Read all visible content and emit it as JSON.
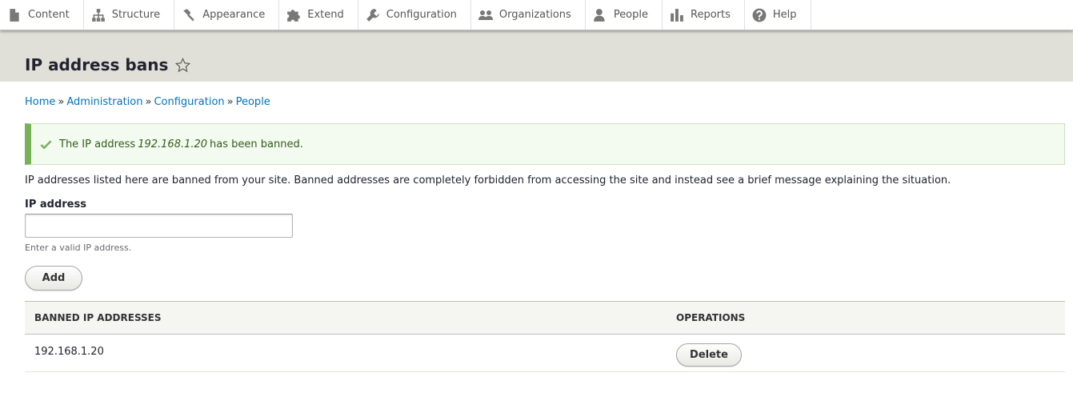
{
  "toolbar": {
    "items": [
      {
        "label": "Content",
        "icon": "file-icon"
      },
      {
        "label": "Structure",
        "icon": "sitemap-icon"
      },
      {
        "label": "Appearance",
        "icon": "paintbrush-icon"
      },
      {
        "label": "Extend",
        "icon": "puzzle-icon"
      },
      {
        "label": "Configuration",
        "icon": "wrench-icon"
      },
      {
        "label": "Organizations",
        "icon": "group-icon"
      },
      {
        "label": "People",
        "icon": "user-icon"
      },
      {
        "label": "Reports",
        "icon": "bar-chart-icon"
      },
      {
        "label": "Help",
        "icon": "help-icon"
      }
    ]
  },
  "page": {
    "title": "IP address bans"
  },
  "breadcrumb": {
    "home": "Home",
    "administration": "Administration",
    "configuration": "Configuration",
    "people": "People",
    "separator": "»"
  },
  "status": {
    "prefix": "The IP address",
    "ip": "192.168.1.20",
    "suffix": "has been banned.",
    "color": "#77b259"
  },
  "description": "IP addresses listed here are banned from your site. Banned addresses are completely forbidden from accessing the site and instead see a brief message explaining the situation.",
  "form": {
    "label": "IP address",
    "value": "",
    "placeholder": "",
    "help": "Enter a valid IP address.",
    "add_label": "Add"
  },
  "table": {
    "headers": [
      "BANNED IP ADDRESSES",
      "OPERATIONS"
    ],
    "rows": [
      {
        "ip": "192.168.1.20",
        "operation": "Delete"
      }
    ]
  },
  "colors": {
    "link": "#0074bd",
    "header_bg": "#e0e0d8"
  }
}
